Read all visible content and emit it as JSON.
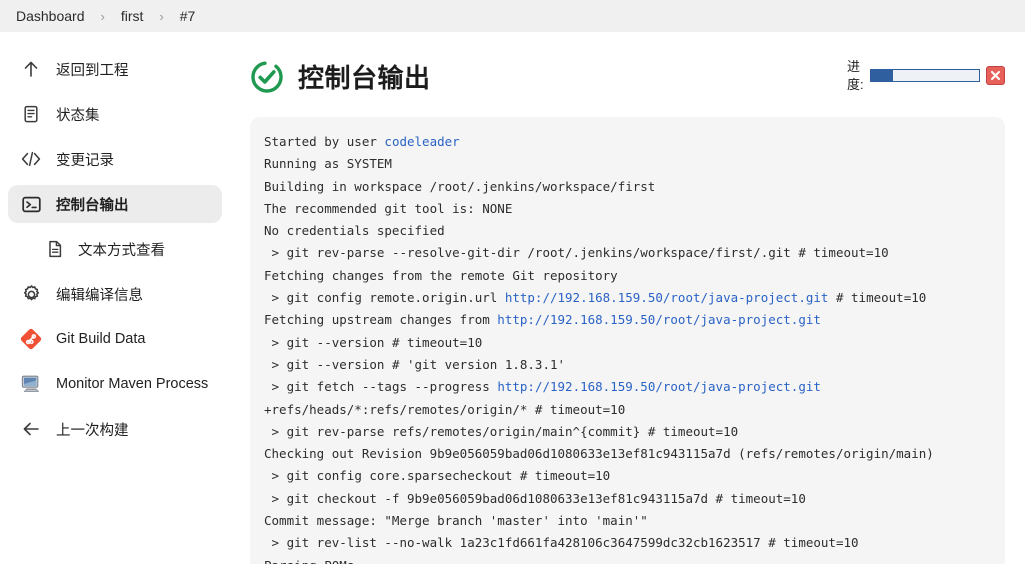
{
  "breadcrumb": {
    "separator": "›",
    "items": [
      {
        "label": "Dashboard"
      },
      {
        "label": "first"
      },
      {
        "label": "#7"
      }
    ]
  },
  "sidebar": {
    "items": [
      {
        "label": "返回到工程",
        "icon": "arrow-up-icon",
        "name": "back-to-project",
        "active": false,
        "sub": false
      },
      {
        "label": "状态集",
        "icon": "document-lines-icon",
        "name": "status",
        "active": false,
        "sub": false
      },
      {
        "label": "变更记录",
        "icon": "code-brackets-icon",
        "name": "changes",
        "active": false,
        "sub": false
      },
      {
        "label": "控制台输出",
        "icon": "terminal-icon",
        "name": "console-output",
        "active": true,
        "sub": false
      },
      {
        "label": "文本方式查看",
        "icon": "file-text-icon",
        "name": "view-as-plain-text",
        "active": false,
        "sub": true
      },
      {
        "label": "编辑编译信息",
        "icon": "gear-icon",
        "name": "edit-build-information",
        "active": false,
        "sub": false
      },
      {
        "label": "Git Build Data",
        "icon": "git-diamond-icon",
        "name": "git-build-data",
        "active": false,
        "sub": false
      },
      {
        "label": "Monitor Maven Process",
        "icon": "monitor-icon",
        "name": "monitor-maven-process",
        "active": false,
        "sub": false
      },
      {
        "label": "上一次构建",
        "icon": "arrow-left-icon",
        "name": "previous-build",
        "active": false,
        "sub": false
      }
    ]
  },
  "main": {
    "title": "控制台输出",
    "status_icon": "success-check-icon",
    "status_color": "#1f9950",
    "progress": {
      "label_line1": "进",
      "label_line2": "度:",
      "percent": 20,
      "fill_color": "#2f5f9e",
      "abort_label": "✖"
    },
    "console": {
      "lines": [
        [
          {
            "t": "Started by user ",
            "k": "plain"
          },
          {
            "t": "codeleader",
            "k": "link"
          }
        ],
        [
          {
            "t": "Running as SYSTEM",
            "k": "plain"
          }
        ],
        [
          {
            "t": "Building in workspace /root/.jenkins/workspace/first",
            "k": "plain"
          }
        ],
        [
          {
            "t": "The recommended git tool is: NONE",
            "k": "plain"
          }
        ],
        [
          {
            "t": "No credentials specified",
            "k": "plain"
          }
        ],
        [
          {
            "t": " > git rev-parse --resolve-git-dir /root/.jenkins/workspace/first/.git # timeout=10",
            "k": "plain"
          }
        ],
        [
          {
            "t": "Fetching changes from the remote Git repository",
            "k": "plain"
          }
        ],
        [
          {
            "t": " > git config remote.origin.url ",
            "k": "plain"
          },
          {
            "t": "http://192.168.159.50/root/java-project.git",
            "k": "link"
          },
          {
            "t": " # timeout=10",
            "k": "plain"
          }
        ],
        [
          {
            "t": "Fetching upstream changes from ",
            "k": "plain"
          },
          {
            "t": "http://192.168.159.50/root/java-project.git",
            "k": "link"
          }
        ],
        [
          {
            "t": " > git --version # timeout=10",
            "k": "plain"
          }
        ],
        [
          {
            "t": " > git --version # 'git version 1.8.3.1'",
            "k": "plain"
          }
        ],
        [
          {
            "t": " > git fetch --tags --progress ",
            "k": "plain"
          },
          {
            "t": "http://192.168.159.50/root/java-project.git",
            "k": "link"
          }
        ],
        [
          {
            "t": "+refs/heads/*:refs/remotes/origin/* # timeout=10",
            "k": "plain"
          }
        ],
        [
          {
            "t": " > git rev-parse refs/remotes/origin/main^{commit} # timeout=10",
            "k": "plain"
          }
        ],
        [
          {
            "t": "Checking out Revision 9b9e056059bad06d1080633e13ef81c943115a7d (refs/remotes/origin/main)",
            "k": "plain"
          }
        ],
        [
          {
            "t": " > git config core.sparsecheckout # timeout=10",
            "k": "plain"
          }
        ],
        [
          {
            "t": " > git checkout -f 9b9e056059bad06d1080633e13ef81c943115a7d # timeout=10",
            "k": "plain"
          }
        ],
        [
          {
            "t": "Commit message: \"Merge branch 'master' into 'main'\"",
            "k": "plain"
          }
        ],
        [
          {
            "t": " > git rev-list --no-walk 1a23c1fd661fa428106c3647599dc32cb1623517 # timeout=10",
            "k": "plain"
          }
        ],
        [
          {
            "t": "Parsing POMs",
            "k": "plain"
          }
        ]
      ]
    }
  }
}
